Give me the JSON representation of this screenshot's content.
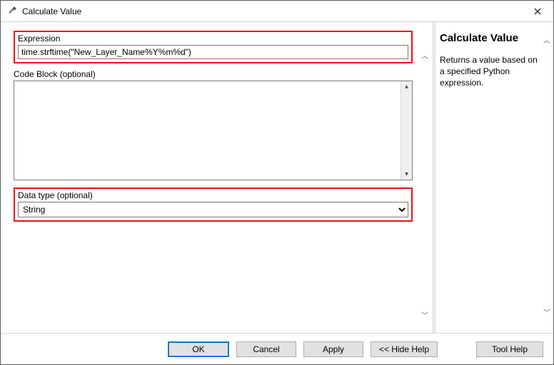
{
  "window": {
    "title": "Calculate Value"
  },
  "form": {
    "expression": {
      "label": "Expression",
      "value": "time.strftime(\"New_Layer_Name%Y%m%d\")"
    },
    "codeblock": {
      "label": "Code Block (optional)",
      "value": ""
    },
    "datatype": {
      "label": "Data type (optional)",
      "selected": "String",
      "options": [
        "String"
      ]
    }
  },
  "buttons": {
    "ok": "OK",
    "cancel": "Cancel",
    "apply": "Apply",
    "hidehelp": "<< Hide Help",
    "toolhelp": "Tool Help"
  },
  "help": {
    "title": "Calculate Value",
    "body": "Returns a value based on a specified Python expression."
  }
}
